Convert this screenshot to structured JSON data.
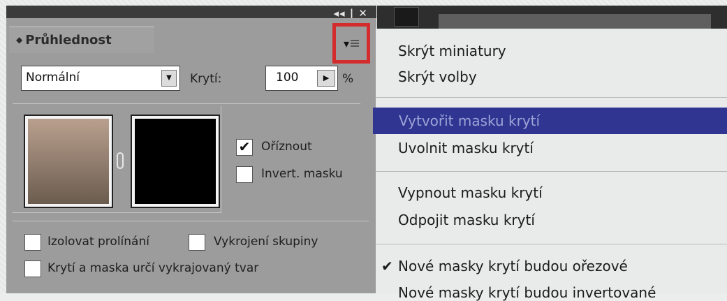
{
  "panel": {
    "title": "Průhlednost",
    "window_controls": "◂◂ | ✕",
    "blend_mode": "Normální",
    "opacity_label": "Krytí:",
    "opacity_value": "100",
    "opacity_unit": "%",
    "clip_label": "Oříznout",
    "clip_checked": true,
    "invert_label": "Invert. masku",
    "invert_checked": false,
    "isolate_label": "Izolovat prolínání",
    "knockout_label": "Vykrojení skupiny",
    "opacity_mask_knockout_label": "Krytí a maska určí vykrajovaný tvar"
  },
  "menu": {
    "items": [
      {
        "label": "Skrýt miniatury"
      },
      {
        "label": "Skrýt volby"
      },
      {
        "label": "Vytvořit masku krytí",
        "highlighted": true
      },
      {
        "label": "Uvolnit masku krytí"
      },
      {
        "label": "Vypnout masku krytí"
      },
      {
        "label": "Odpojit masku krytí"
      },
      {
        "label": "Nové masky krytí budou ořezové",
        "checked": true
      },
      {
        "label": "Nové masky krytí budou invertované"
      }
    ]
  },
  "colors": {
    "panel_bg": "#9c9c9c",
    "menu_bg": "#e9ebea",
    "highlight": "#2f3591",
    "annotation_box": "#d42c2c"
  }
}
